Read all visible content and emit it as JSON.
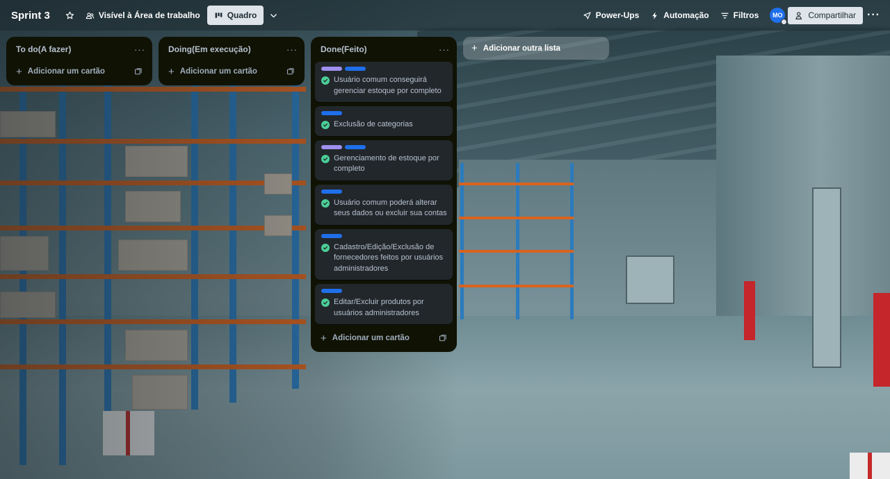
{
  "header": {
    "board_title": "Sprint 3",
    "visibility_label": "Visível à Área de trabalho",
    "view_label": "Quadro",
    "powerups_label": "Power-Ups",
    "automation_label": "Automação",
    "filters_label": "Filtros",
    "avatar_initials": "MO",
    "share_label": "Compartilhar",
    "more_label": "···"
  },
  "lists": [
    {
      "title": "To do(A fazer)",
      "menu": "···",
      "add_card_label": "Adicionar um cartão",
      "cards": []
    },
    {
      "title": "Doing(Em execução)",
      "menu": "···",
      "add_card_label": "Adicionar um cartão",
      "cards": []
    },
    {
      "title": "Done(Feito)",
      "menu": "···",
      "add_card_label": "Adicionar um cartão",
      "cards": [
        {
          "labels": [
            "purple",
            "blue"
          ],
          "text": "Usuário comum conseguirá gerenciar estoque por completo",
          "done": true
        },
        {
          "labels": [
            "blue"
          ],
          "text": "Exclusão de categorias",
          "done": true
        },
        {
          "labels": [
            "purple",
            "blue"
          ],
          "text": "Gerenciamento de estoque por completo",
          "done": true
        },
        {
          "labels": [
            "blue"
          ],
          "text": "Usuário comum poderá alterar seus dados ou excluir sua contas",
          "done": true
        },
        {
          "labels": [
            "blue"
          ],
          "text": "Cadastro/Edição/Exclusão de fornecedores feitos por usuários administradores",
          "done": true
        },
        {
          "labels": [
            "blue"
          ],
          "text": "Editar/Excluir produtos por usuários administradores",
          "done": true
        }
      ]
    }
  ],
  "add_list_label": "Adicionar outra lista",
  "colors": {
    "list_bg": "#101204",
    "card_bg": "#22272b",
    "label_purple": "#9f8fef",
    "label_blue": "#1f6feb",
    "check_green": "#4bce97",
    "avatar_blue": "#1f6feb"
  },
  "icons": {
    "star": "star-icon",
    "visibility": "workspace-visibility-icon",
    "view": "board-view-icon",
    "chevron": "chevron-down-icon",
    "powerups": "rocket-icon",
    "automation": "lightning-icon",
    "filters": "filter-icon",
    "share": "add-person-icon",
    "template": "card-template-icon",
    "check": "check-circle-icon"
  }
}
